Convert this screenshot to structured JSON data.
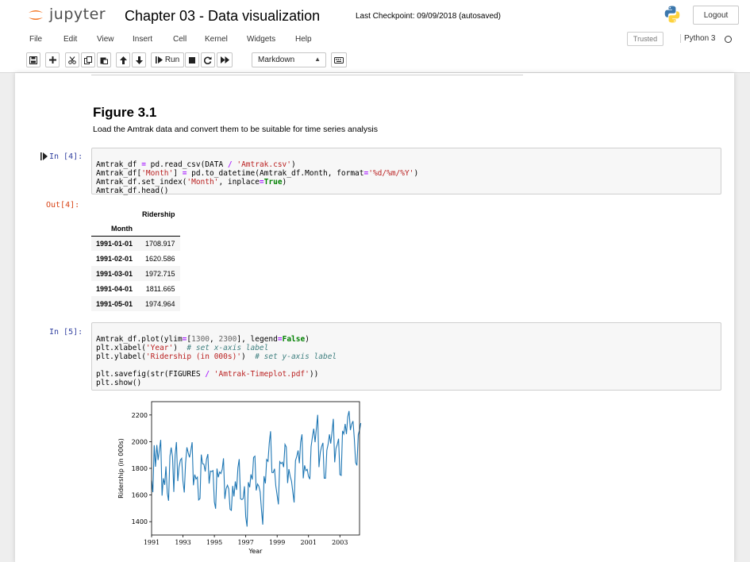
{
  "header": {
    "logo_text": "jupyter",
    "notebook_title": "Chapter 03 - Data visualization",
    "checkpoint": "Last Checkpoint: 09/09/2018  (autosaved)",
    "logout_label": "Logout",
    "trusted_label": "Trusted",
    "kernel_name": "Python 3"
  },
  "menu": {
    "items": [
      "File",
      "Edit",
      "View",
      "Insert",
      "Cell",
      "Kernel",
      "Widgets",
      "Help"
    ]
  },
  "toolbar": {
    "run_label": "Run",
    "cell_type": "Markdown",
    "icons": [
      "save-icon",
      "plus-icon",
      "cut-icon",
      "copy-icon",
      "paste-icon",
      "arrow-up-icon",
      "arrow-down-icon",
      "run-icon",
      "stop-icon",
      "restart-icon",
      "fast-forward-icon",
      "keyboard-icon"
    ]
  },
  "markdown": {
    "heading": "Figure 3.1",
    "text": "Load the Amtrak data and convert them to be suitable for time series analysis"
  },
  "cells": {
    "in4_prompt": "In [4]:",
    "out4_prompt": "Out[4]:",
    "in5_prompt": "In [5]:",
    "in4_code": [
      "Amtrak_df = pd.read_csv(DATA / 'Amtrak.csv')",
      "Amtrak_df['Month'] = pd.to_datetime(Amtrak_df.Month, format='%d/%m/%Y')",
      "Amtrak_df.set_index('Month', inplace=True)",
      "Amtrak_df.head()"
    ],
    "in5_code": [
      "Amtrak_df.plot(ylim=[1300, 2300], legend=False)",
      "plt.xlabel('Year')  # set x-axis label",
      "plt.ylabel('Ridership (in 000s)')  # set y-axis label",
      "",
      "plt.savefig(str(FIGURES / 'Amtrak-Timeplot.pdf'))",
      "plt.show()"
    ]
  },
  "dataframe": {
    "column": "Ridership",
    "index_name": "Month",
    "rows": [
      {
        "month": "1991-01-01",
        "ridership": "1708.917"
      },
      {
        "month": "1991-02-01",
        "ridership": "1620.586"
      },
      {
        "month": "1991-03-01",
        "ridership": "1972.715"
      },
      {
        "month": "1991-04-01",
        "ridership": "1811.665"
      },
      {
        "month": "1991-05-01",
        "ridership": "1974.964"
      }
    ]
  },
  "chart_data": {
    "type": "line",
    "xlabel": "Year",
    "ylabel": "Ridership (in 000s)",
    "xlim": [
      1991.0,
      2004.25
    ],
    "ylim": [
      1300,
      2300
    ],
    "x_ticks": [
      "1991",
      "1993",
      "1995",
      "1997",
      "1999",
      "2001",
      "2003"
    ],
    "y_ticks": [
      "1400",
      "1600",
      "1800",
      "2000",
      "2200"
    ],
    "line_color": "#1f77b4",
    "grid": false,
    "legend": false,
    "x_start": "1991-01",
    "x_step": "1 month",
    "values": [
      1709,
      1621,
      1973,
      1812,
      1975,
      1862,
      1940,
      2013,
      1596,
      1725,
      1676,
      1814,
      1615,
      1557,
      1891,
      1956,
      1885,
      1623,
      1903,
      1997,
      1704,
      1810,
      1862,
      1875,
      1705,
      1619,
      1837,
      1957,
      1917,
      1882,
      1933,
      1996,
      1673,
      1753,
      1720,
      1734,
      1563,
      1574,
      1903,
      1834,
      1831,
      1776,
      1868,
      1907,
      1686,
      1779,
      1776,
      1783,
      1548,
      1497,
      1798,
      1733,
      1772,
      1761,
      1792,
      1875,
      1571,
      1647,
      1673,
      1646,
      1493,
      1485,
      1668,
      1589,
      1702,
      1638,
      1806,
      1869,
      1572,
      1566,
      1572,
      1665,
      1438,
      1363,
      1696,
      1658,
      1754,
      1716,
      1882,
      1891,
      1634,
      1682,
      1666,
      1624,
      1493,
      1378,
      1741,
      1687,
      1866,
      1853,
      1991,
      2078,
      1769,
      1768,
      1797,
      1669,
      1598,
      1530,
      1850,
      1836,
      1846,
      1809,
      1980,
      1961,
      1689,
      1794,
      1738,
      1704,
      1620,
      1544,
      1858,
      1889,
      1934,
      1838,
      1997,
      2055,
      1725,
      1822,
      1783,
      1792,
      1740,
      1719,
      1964,
      2038,
      2097,
      1996,
      2097,
      2201,
      1809,
      1920,
      1963,
      1991,
      1726,
      1726,
      1935,
      1983,
      2055,
      1986,
      2073,
      2171,
      1845,
      1948,
      1980,
      2022,
      1753,
      1747,
      2081,
      2058,
      2133,
      2057,
      2188,
      2230,
      2087,
      2131,
      2154,
      2026,
      1843,
      1822,
      2052,
      2085,
      2139
    ]
  }
}
